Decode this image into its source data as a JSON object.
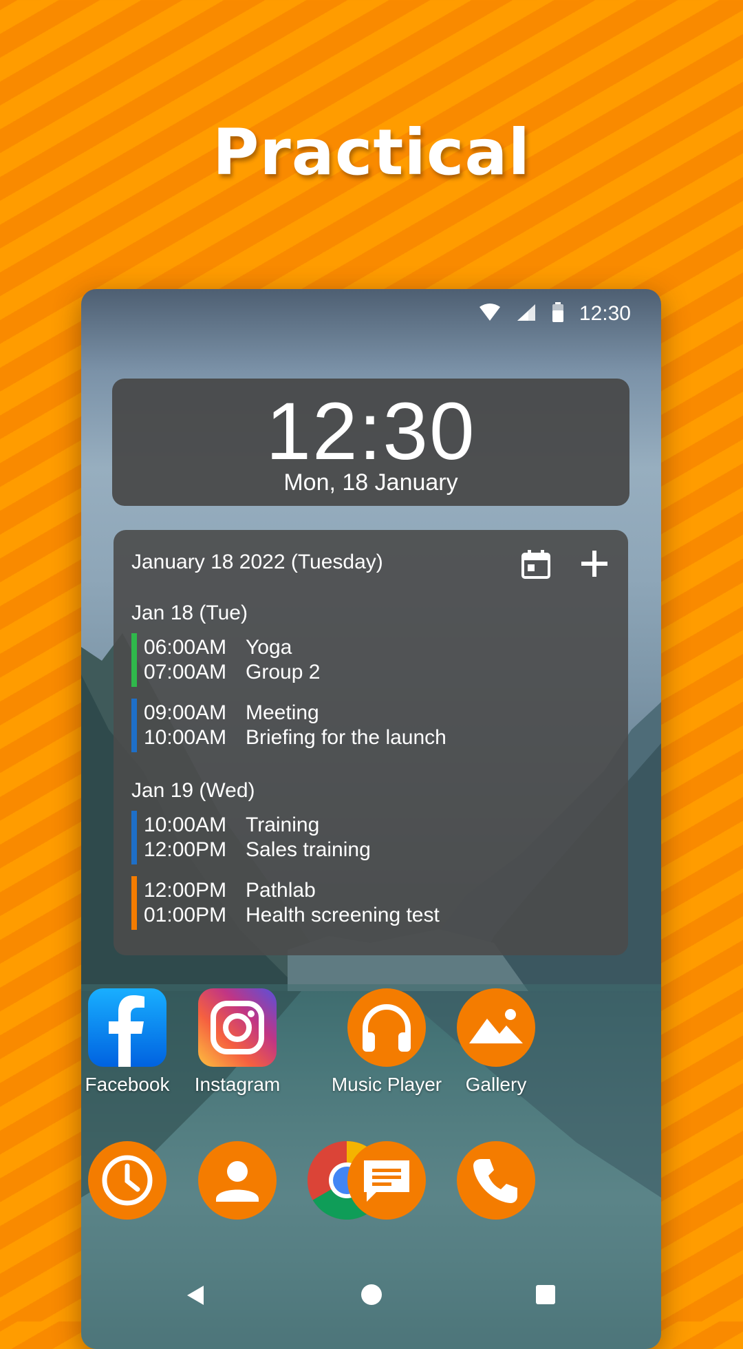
{
  "headline": "Practical",
  "status": {
    "time": "12:30",
    "icons": [
      "wifi-icon",
      "signal-icon",
      "battery-icon"
    ]
  },
  "clock_widget": {
    "time": "12:30",
    "date": "Mon, 18 January"
  },
  "agenda": {
    "header": "January 18 2022 (Tuesday)",
    "days": [
      {
        "label": "Jan 18 (Tue)",
        "events": [
          {
            "color": "#2FB84B",
            "start": "06:00AM",
            "title": "Yoga",
            "end": "07:00AM",
            "detail": "Group 2"
          },
          {
            "color": "#1E6FC8",
            "start": "09:00AM",
            "title": "Meeting",
            "end": "10:00AM",
            "detail": "Briefing for the launch"
          }
        ]
      },
      {
        "label": "Jan 19 (Wed)",
        "events": [
          {
            "color": "#1E6FC8",
            "start": "10:00AM",
            "title": "Training",
            "end": "12:00PM",
            "detail": "Sales training"
          },
          {
            "color": "#F47C00",
            "start": "12:00PM",
            "title": "Pathlab",
            "end": "01:00PM",
            "detail": "Health screening test"
          }
        ]
      }
    ]
  },
  "apps": [
    {
      "label": "Facebook",
      "icon": "facebook-icon"
    },
    {
      "label": "Instagram",
      "icon": "instagram-icon"
    },
    {
      "label": "Music Player",
      "icon": "headphones-icon"
    },
    {
      "label": "Gallery",
      "icon": "image-icon"
    }
  ],
  "dock": [
    "clock-icon",
    "contacts-icon",
    "chrome-icon",
    "messages-icon",
    "phone-icon"
  ],
  "colors": {
    "accent": "#F47C00",
    "widget_bg": "#464646",
    "facebook": "#1877F2"
  }
}
